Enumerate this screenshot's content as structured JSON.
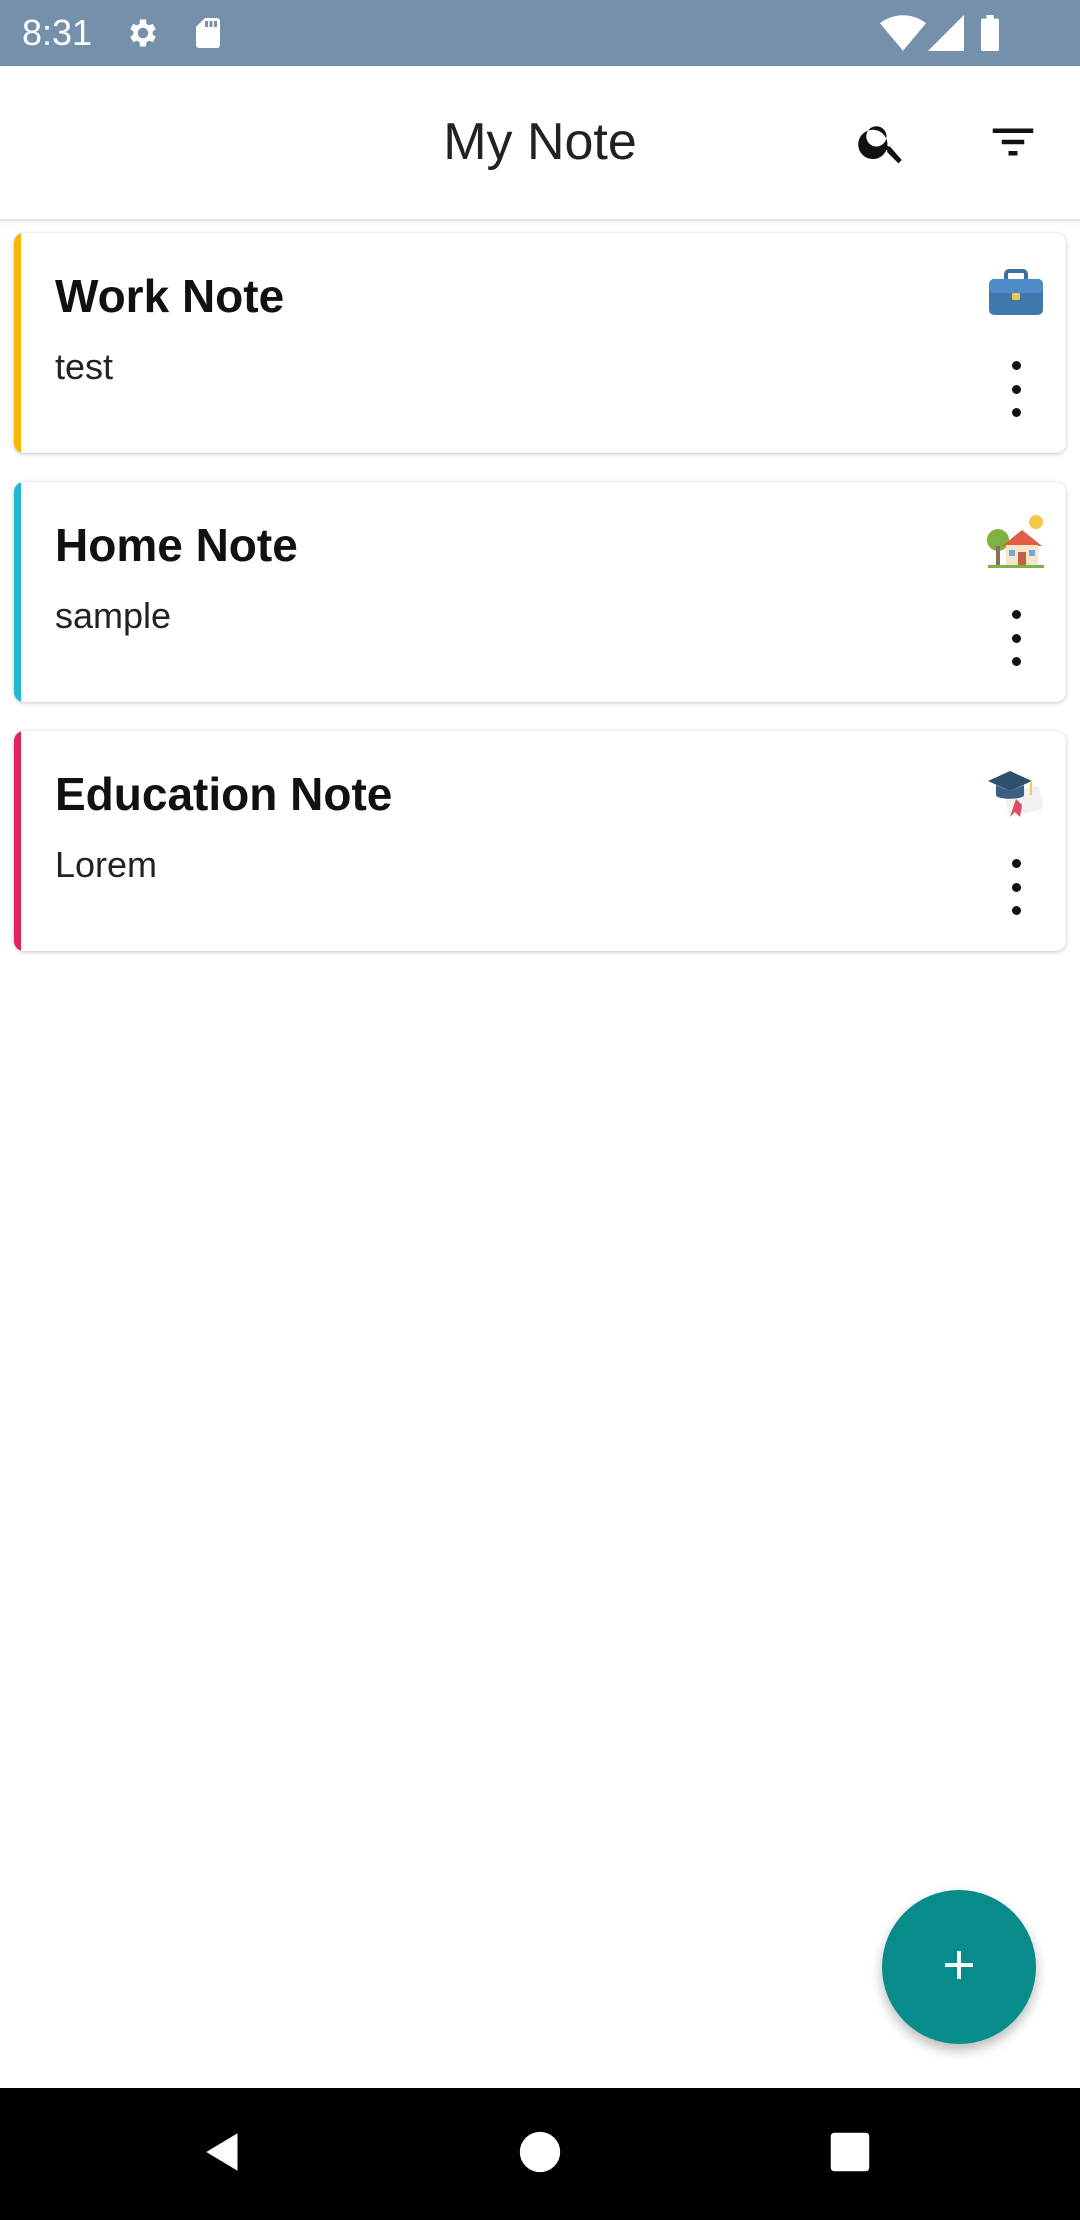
{
  "status_bar": {
    "time": "8:31",
    "background_color": "#7490ab",
    "icons": [
      "gear-icon",
      "sd-card-icon",
      "wifi-icon",
      "signal-icon",
      "battery-icon"
    ]
  },
  "app_bar": {
    "title": "My Note",
    "actions": [
      "search-icon",
      "filter-icon"
    ]
  },
  "notes": [
    {
      "title": "Work Note",
      "body": "test",
      "accent_color": "#f5b800",
      "icon": "briefcase-icon"
    },
    {
      "title": "Home Note",
      "body": "sample",
      "accent_color": "#1fb8cf",
      "icon": "house-icon"
    },
    {
      "title": "Education Note",
      "body": "Lorem",
      "accent_color": "#e0245e",
      "icon": "graduation-cap-icon"
    }
  ],
  "fab": {
    "icon": "plus-icon",
    "color": "#078b8b"
  },
  "nav_bar": {
    "buttons": [
      "back-icon",
      "home-icon",
      "recents-icon"
    ]
  }
}
